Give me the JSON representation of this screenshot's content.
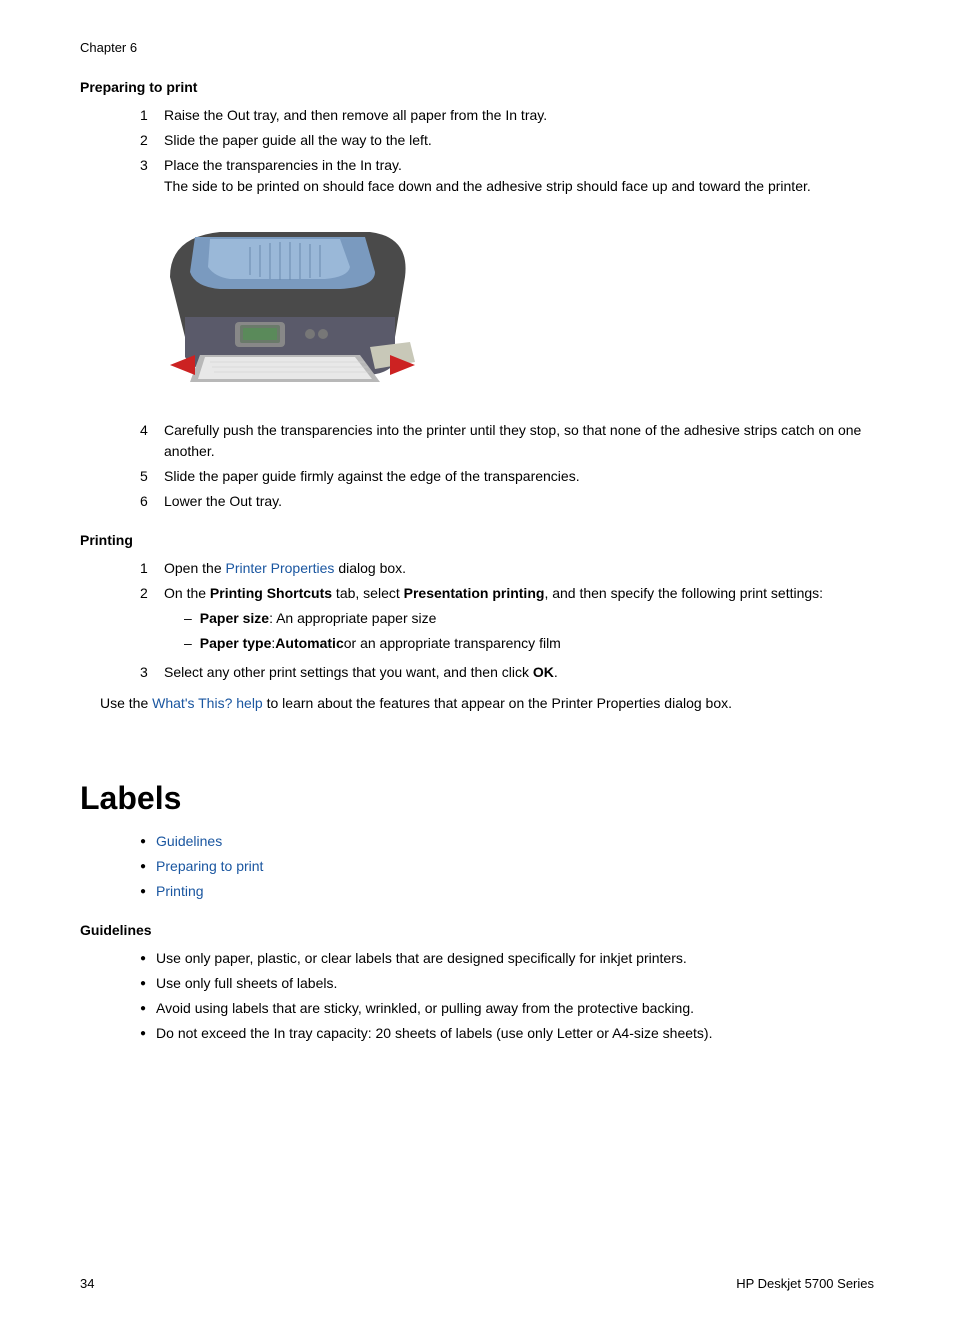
{
  "footer": {
    "page_number": "34",
    "product_name": "HP Deskjet 5700 Series"
  },
  "chapter": {
    "label": "Chapter 6"
  },
  "preparing_to_print_section": {
    "heading": "Preparing to print",
    "steps": [
      {
        "num": "1",
        "text": "Raise the Out tray, and then remove all paper from the In tray."
      },
      {
        "num": "2",
        "text": "Slide the paper guide all the way to the left."
      },
      {
        "num": "3",
        "text": "Place the transparencies in the In tray."
      }
    ],
    "step3_note": "The side to be printed on should face down and the adhesive strip should face up and toward the printer.",
    "steps_continued": [
      {
        "num": "4",
        "text": "Carefully push the transparencies into the printer until they stop, so that none of the adhesive strips catch on one another."
      },
      {
        "num": "5",
        "text": "Slide the paper guide firmly against the edge of the transparencies."
      },
      {
        "num": "6",
        "text": "Lower the Out tray."
      }
    ]
  },
  "printing_section": {
    "heading": "Printing",
    "steps": [
      {
        "num": "1",
        "text_prefix": "Open the ",
        "link_text": "Printer Properties",
        "text_suffix": " dialog box."
      },
      {
        "num": "2",
        "text": "On the Printing Shortcuts tab, select Presentation printing, and then specify the following print settings:"
      },
      {
        "num": "3",
        "text": "Select any other print settings that you want, and then click OK."
      }
    ],
    "sub_settings": [
      {
        "label": "Paper size",
        "text": ": An appropriate paper size"
      },
      {
        "label": "Paper type",
        "text": ": Automatic or an appropriate transparency film"
      }
    ],
    "use_text_prefix": "Use the ",
    "use_link": "What's This? help",
    "use_text_suffix": " to learn about the features that appear on the Printer Properties dialog box."
  },
  "labels_section": {
    "heading": "Labels",
    "toc_items": [
      {
        "text": "Guidelines",
        "link": true
      },
      {
        "text": "Preparing to print",
        "link": true
      },
      {
        "text": "Printing",
        "link": true
      }
    ]
  },
  "guidelines_section": {
    "heading": "Guidelines",
    "bullets": [
      "Use only paper, plastic, or clear labels that are designed specifically for inkjet printers.",
      "Use only full sheets of labels.",
      "Avoid using labels that are sticky, wrinkled, or pulling away from the protective backing.",
      "Do not exceed the In tray capacity: 20 sheets of labels (use only Letter or A4-size sheets)."
    ]
  }
}
